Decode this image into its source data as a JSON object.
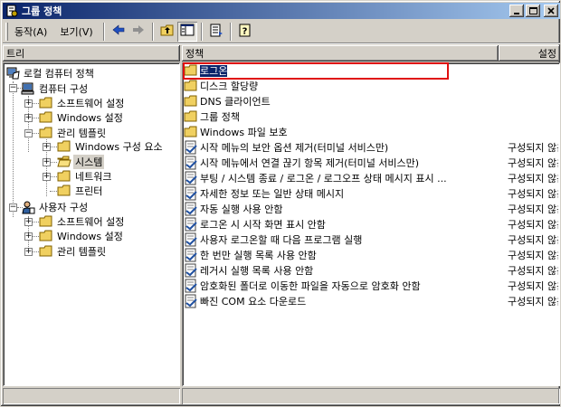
{
  "window": {
    "title": "그룹 정책"
  },
  "menu": {
    "action": "동작(A)",
    "view": "보기(V)"
  },
  "icons": {
    "title": "policy-doc-icon",
    "back": "back-arrow-icon",
    "forward": "forward-arrow-icon",
    "up": "up-folder-icon",
    "show_hide_tree": "show-hide-tree-icon",
    "export": "export-list-icon",
    "help": "help-icon"
  },
  "tree_pane": {
    "header": "트리",
    "nodes": [
      {
        "label": "로컬 컴퓨터 정책"
      },
      {
        "label": "컴퓨터 구성"
      },
      {
        "label": "소프트웨어 설정"
      },
      {
        "label": "Windows 설정"
      },
      {
        "label": "관리 템플릿"
      },
      {
        "label": "Windows 구성 요소"
      },
      {
        "label": "시스템"
      },
      {
        "label": "네트워크"
      },
      {
        "label": "프린터"
      },
      {
        "label": "사용자 구성"
      },
      {
        "label": "소프트웨어 설정"
      },
      {
        "label": "Windows 설정"
      },
      {
        "label": "관리 템플릿"
      }
    ]
  },
  "list_pane": {
    "columns": {
      "name": "정책",
      "setting": "설정"
    },
    "rows": [
      {
        "name": "로그온",
        "state": ""
      },
      {
        "name": "디스크 할당량",
        "state": ""
      },
      {
        "name": "DNS 클라이언트",
        "state": ""
      },
      {
        "name": "그룹 정책",
        "state": ""
      },
      {
        "name": "Windows 파일 보호",
        "state": ""
      },
      {
        "name": "시작 메뉴의 보안 옵션 제거(터미널 서비스만)",
        "state": "구성되지 않음"
      },
      {
        "name": "시작 메뉴에서 연결 끊기 항목 제거(터미널 서비스만)",
        "state": "구성되지 않음"
      },
      {
        "name": "부팅 / 시스템 종료 / 로그온 / 로그오프 상태 메시지 표시 ...",
        "state": "구성되지 않음"
      },
      {
        "name": "자세한 정보 또는 일반 상태 메시지",
        "state": "구성되지 않음"
      },
      {
        "name": "자동 실행 사용 안함",
        "state": "구성되지 않음"
      },
      {
        "name": "로그온 시 시작 화면 표시 안함",
        "state": "구성되지 않음"
      },
      {
        "name": "사용자 로그온할 때 다음 프로그램 실행",
        "state": "구성되지 않음"
      },
      {
        "name": "한 번만 실행 목록 사용 안함",
        "state": "구성되지 않음"
      },
      {
        "name": "레거시 실행 목록 사용 안함",
        "state": "구성되지 않음"
      },
      {
        "name": "암호화된 폴더로 이동한 파일을 자동으로 암호화 안함",
        "state": "구성되지 않음"
      },
      {
        "name": "빠진 COM 요소 다운로드",
        "state": "구성되지 않음"
      }
    ]
  }
}
